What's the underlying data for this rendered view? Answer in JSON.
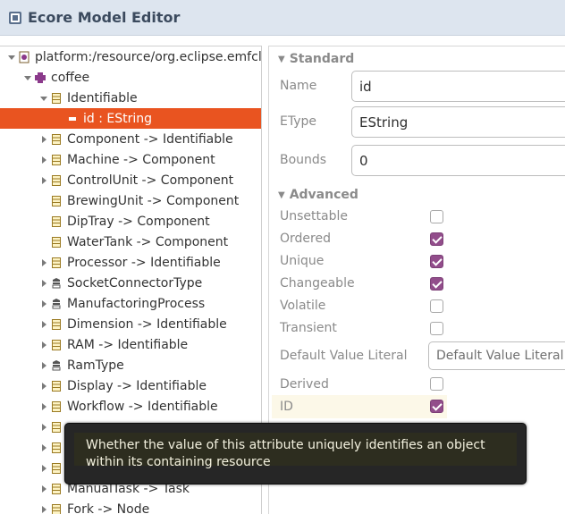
{
  "window": {
    "title": "Ecore Model Editor"
  },
  "tree": {
    "items": [
      {
        "label": "platform:/resource/org.eclipse.emfcl",
        "icon": "resource-icon",
        "twisty": "expanded",
        "selected": false
      },
      {
        "label": "coffee",
        "icon": "package-icon",
        "twisty": "expanded",
        "selected": false
      },
      {
        "label": "Identifiable",
        "icon": "class-icon",
        "twisty": "expanded",
        "selected": false
      },
      {
        "label": "id : EString",
        "icon": "attribute-icon",
        "twisty": "none",
        "selected": true
      },
      {
        "label": "Component -> Identifiable",
        "icon": "class-icon",
        "twisty": "collapsed",
        "selected": false
      },
      {
        "label": "Machine -> Component",
        "icon": "class-icon",
        "twisty": "collapsed",
        "selected": false
      },
      {
        "label": "ControlUnit -> Component",
        "icon": "class-icon",
        "twisty": "collapsed",
        "selected": false
      },
      {
        "label": "BrewingUnit -> Component",
        "icon": "class-icon",
        "twisty": "none",
        "selected": false
      },
      {
        "label": "DipTray -> Component",
        "icon": "class-icon",
        "twisty": "none",
        "selected": false
      },
      {
        "label": "WaterTank -> Component",
        "icon": "class-icon",
        "twisty": "none",
        "selected": false
      },
      {
        "label": "Processor -> Identifiable",
        "icon": "class-icon",
        "twisty": "collapsed",
        "selected": false
      },
      {
        "label": "SocketConnectorType",
        "icon": "enum-icon",
        "twisty": "collapsed",
        "selected": false
      },
      {
        "label": "ManufactoringProcess",
        "icon": "enum-icon",
        "twisty": "collapsed",
        "selected": false
      },
      {
        "label": "Dimension -> Identifiable",
        "icon": "class-icon",
        "twisty": "collapsed",
        "selected": false
      },
      {
        "label": "RAM -> Identifiable",
        "icon": "class-icon",
        "twisty": "collapsed",
        "selected": false
      },
      {
        "label": "RamType",
        "icon": "enum-icon",
        "twisty": "collapsed",
        "selected": false
      },
      {
        "label": "Display -> Identifiable",
        "icon": "class-icon",
        "twisty": "collapsed",
        "selected": false
      },
      {
        "label": "Workflow -> Identifiable",
        "icon": "class-icon",
        "twisty": "collapsed",
        "selected": false
      },
      {
        "label": "",
        "icon": "class-icon",
        "twisty": "collapsed",
        "selected": false
      },
      {
        "label": "",
        "icon": "class-icon",
        "twisty": "collapsed",
        "selected": false
      },
      {
        "label": "",
        "icon": "class-icon",
        "twisty": "collapsed",
        "selected": false
      },
      {
        "label": "ManualTask -> Task",
        "icon": "class-icon",
        "twisty": "collapsed",
        "selected": false
      },
      {
        "label": "Fork -> Node",
        "icon": "class-icon",
        "twisty": "collapsed",
        "selected": false
      }
    ]
  },
  "properties": {
    "standard_section": "Standard",
    "name_label": "Name",
    "name_value": "id",
    "etype_label": "EType",
    "etype_value": "EString",
    "bounds_label": "Bounds",
    "bounds_value": "0",
    "advanced_section": "Advanced",
    "checkboxes": [
      {
        "label": "Unsettable",
        "checked": false
      },
      {
        "label": "Ordered",
        "checked": true
      },
      {
        "label": "Unique",
        "checked": true
      },
      {
        "label": "Changeable",
        "checked": true
      },
      {
        "label": "Volatile",
        "checked": false
      },
      {
        "label": "Transient",
        "checked": false
      }
    ],
    "default_value_label": "Default Value Literal",
    "default_value_placeholder": "Default Value Literal",
    "derived_label": "Derived",
    "derived_checked": false,
    "id_label": "ID",
    "id_checked": true
  },
  "tooltip": {
    "text": "Whether the value of this attribute uniquely identifies an object within its containing resource"
  },
  "colors": {
    "selection": "#e95420",
    "checkbox_checked": "#924d8b",
    "titlebar": "#dde5ef",
    "tooltip_bg": "#262626"
  }
}
